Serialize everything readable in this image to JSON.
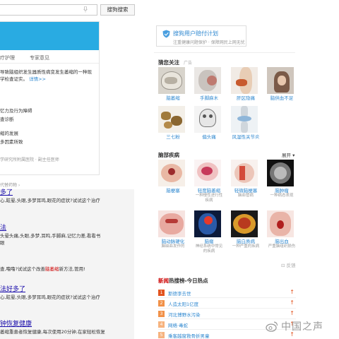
{
  "search": {
    "button_label": "搜狗搜索",
    "value": ""
  },
  "left_card": {
    "tabs": [
      "疗护理",
      "专家意见"
    ],
    "body_lines": [
      "导致脑组织发生器质性病变发生萎缩的一种现",
      "学检查证实。"
    ],
    "detail_link": "详情>>",
    "list": [
      "忆力及行为障碍",
      "查诊断",
      "缩的发展",
      "多因素所致"
    ],
    "footer": "学研究所附属医院 · 副主任医师"
  },
  "results_note": "代替药物 ›",
  "results": [
    {
      "title": "多了",
      "snippet": "心,眩晕,头眼,多梦耳鸣,眼花的症状?试试这个治疗"
    },
    {
      "title": "法",
      "snippet": "头晕头痛,头眼,多梦,耳鸣,手脚麻,记忆力差,看看书",
      "snippet2": "眼"
    },
    {
      "title": "",
      "snippet_pre": "查,噜噜?试试这个改善",
      "snippet_hl": "脑萎缩",
      "snippet_post": "新方法,管用!"
    },
    {
      "title": "法好多了",
      "snippet": "心,眩晕,头眼,多梦耳鸣,眼花的症状?试试这个治疗"
    },
    {
      "title": "钟恢复健康",
      "snippet": "萎缩重患者恢复健康,每次使用20分钟,在家轻松恢复"
    }
  ],
  "promo": {
    "title": "搜狗用户赔付计划",
    "subtitle": "注重健康问题保护 · 保障网民上网无忧"
  },
  "guess": {
    "title": "猜您关注",
    "ad_label": "广告",
    "items": [
      {
        "label": "脑萎缩"
      },
      {
        "label": "手脚麻木"
      },
      {
        "label": "肝区隐痛"
      },
      {
        "label": "脑供血不足"
      },
      {
        "label": "三七粉"
      },
      {
        "label": "偏头痛"
      },
      {
        "label": "风湿性关节炎"
      }
    ]
  },
  "brain": {
    "title": "脑部疾病",
    "more": "展开",
    "items": [
      {
        "label": "脑梗塞",
        "sub": ""
      },
      {
        "label": "轻度脑萎缩",
        "sub": "一种慢性进行性疾病"
      },
      {
        "label": "轻微脑梗塞",
        "sub": "脑血管病"
      },
      {
        "label": "脑肿瘤",
        "sub": "一种病态表现"
      },
      {
        "label": "脑动脉硬化",
        "sub": "脑缺血发作的"
      },
      {
        "label": "脑瘤",
        "sub": "神经系统中常见的疾病"
      },
      {
        "label": "脑白质病",
        "sub": "一种严重的疾病"
      },
      {
        "label": "脑出血",
        "sub": "严重脑组织损伤"
      }
    ]
  },
  "feedback_label": "反馈",
  "hot": {
    "title_red": "新闻",
    "title_rest": "热搜榜-今日热点",
    "items": [
      {
        "rank": "1",
        "text": "斯德李去世"
      },
      {
        "rank": "2",
        "text": "人造太阳1亿度"
      },
      {
        "rank": "3",
        "text": "河北博野水污染"
      },
      {
        "rank": "4",
        "text": "网络·毒蛇"
      },
      {
        "rank": "5",
        "text": "乘客越窗救骨折男童"
      }
    ],
    "colors": {
      "top": "#e2541f",
      "mid": "#f19149",
      "low": "#f6b37f"
    }
  },
  "watermark": "中国之声"
}
